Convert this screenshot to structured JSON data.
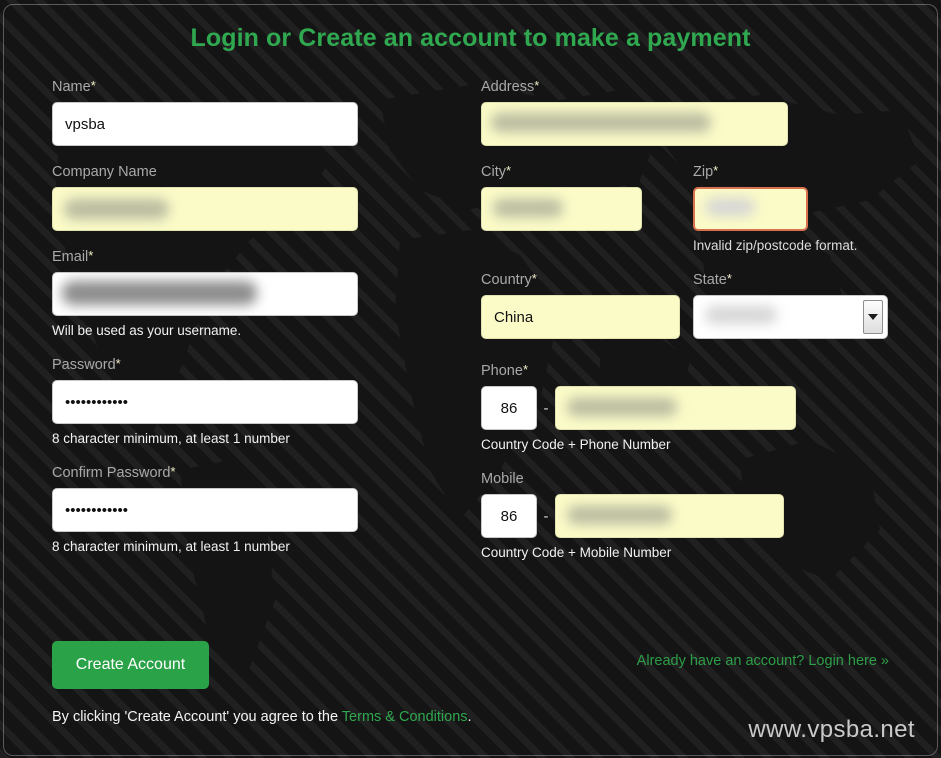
{
  "page": {
    "title": "Login or Create an account to make a payment",
    "watermark": "www.vpsba.net",
    "accent_green": "#2fa84f",
    "button_green": "#2aa348",
    "autofill_yellow": "#fbfbc8",
    "error_border": "#d9714f",
    "background": "#141414",
    "label_color": "#a9a9a9"
  },
  "left_column": {
    "name": {
      "label": "Name",
      "required": true,
      "required_marker": "*",
      "value": "vpsba",
      "autofilled": false,
      "redacted": false
    },
    "company_name": {
      "label": "Company Name",
      "required": false,
      "required_marker": "",
      "value": "",
      "autofilled": true,
      "redacted": true
    },
    "email": {
      "label": "Email",
      "required": true,
      "required_marker": "*",
      "value": "",
      "autofilled": false,
      "redacted": true,
      "help": "Will be used as your username."
    },
    "password": {
      "label": "Password",
      "required": true,
      "required_marker": "*",
      "value": "••••••••••••",
      "autofilled": false,
      "help": "8 character minimum, at least 1 number"
    },
    "confirm_password": {
      "label": "Confirm Password",
      "required": true,
      "required_marker": "*",
      "value": "••••••••••••",
      "autofilled": false,
      "help": "8 character minimum, at least 1 number"
    }
  },
  "right_column": {
    "address": {
      "label": "Address",
      "required": true,
      "required_marker": "*",
      "value": "",
      "autofilled": true,
      "redacted": true
    },
    "city": {
      "label": "City",
      "required": true,
      "required_marker": "*",
      "value": "",
      "autofilled": true,
      "redacted": true
    },
    "zip": {
      "label": "Zip",
      "required": true,
      "required_marker": "*",
      "value": "",
      "autofilled": true,
      "redacted": true,
      "invalid": true,
      "error": "Invalid zip/postcode format."
    },
    "country": {
      "label": "Country",
      "required": true,
      "required_marker": "*",
      "value": "China",
      "autofilled": true,
      "redacted": false
    },
    "state": {
      "label": "State",
      "required": true,
      "required_marker": "*",
      "value": "",
      "autofilled": false,
      "redacted": true,
      "control": "select",
      "arrow_icon": "chevron-down-icon"
    },
    "phone": {
      "label": "Phone",
      "required": true,
      "required_marker": "*",
      "country_code": "86",
      "separator": "-",
      "number": "",
      "number_autofilled": true,
      "redacted": true,
      "help": "Country Code + Phone Number"
    },
    "mobile": {
      "label": "Mobile",
      "required": false,
      "required_marker": "",
      "country_code": "86",
      "separator": "-",
      "number": "",
      "number_autofilled": true,
      "redacted": true,
      "help": "Country Code + Mobile Number"
    }
  },
  "footer": {
    "create_account_label": "Create Account",
    "login_link": "Already have an account? Login here »",
    "terms_prefix": "By clicking 'Create Account' you agree to the ",
    "terms_link": "Terms & Conditions",
    "terms_suffix": "."
  }
}
